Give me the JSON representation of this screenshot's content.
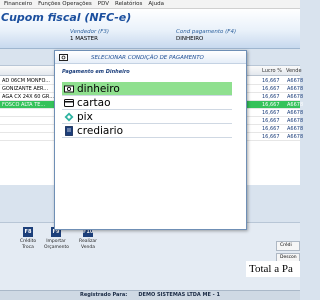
{
  "menu": [
    "Financeiro",
    "Funções Operações",
    "PDV",
    "Relatórios",
    "Ajuda"
  ],
  "header": {
    "title": "Cupom fiscal (NFC-e)",
    "vendedor_label": "Vendedor (F3)",
    "vendedor_value": "1  MASTER",
    "cond_label": "Cond pagamento (F4)",
    "cond_value": "DINHEIRO"
  },
  "grid": {
    "columns": [
      "Lucro %",
      "Vende"
    ],
    "rows": [
      {
        "desc": "AD 06CM MONFO...",
        "c1": "16,667",
        "c2": "A6678"
      },
      {
        "desc": "GONIZANTE AER...",
        "c1": "16,667",
        "c2": "A6678"
      },
      {
        "desc": "AGA CX 24X 60 GR...",
        "c1": "16,667",
        "c2": "A6678"
      },
      {
        "desc": "FOSCO ALTA TE...",
        "c1": "16,667",
        "c2": "A6678"
      },
      {
        "desc": "",
        "c1": "16,667",
        "c2": "A6678"
      },
      {
        "desc": "",
        "c1": "16,667",
        "c2": "A6678"
      },
      {
        "desc": "",
        "c1": "16,667",
        "c2": "A6678"
      },
      {
        "desc": "",
        "c1": "16,667",
        "c2": "A6678"
      }
    ]
  },
  "modal": {
    "title": "SELECIONAR CONDIÇÃO DE PAGAMENTO",
    "subtitle": "Pagamento em Dinheiro",
    "options": [
      {
        "label": "dinheiro",
        "icon": "cash-icon"
      },
      {
        "label": "cartao",
        "icon": "card-icon"
      },
      {
        "label": "pix",
        "icon": "pix-icon"
      },
      {
        "label": "crediario",
        "icon": "notebook-icon"
      }
    ],
    "selected_index": 0
  },
  "toolbar": {
    "tools": [
      {
        "key": "F8",
        "label": "Crédito\nTroca"
      },
      {
        "key": "F9",
        "label": "Importar\nOrçamento"
      },
      {
        "key": "F10",
        "label": "Realizar\nVenda"
      }
    ],
    "btn1": "Crédi",
    "btn2": "Descon",
    "total": "Total a Pa"
  },
  "status": {
    "label": "Registrado Para:",
    "value": "DEMO SISTEMAS LTDA ME - 1"
  },
  "colors": {
    "accent": "#1b4f9e",
    "selected_row": "#35c25a",
    "selected_option": "#8fe08f"
  }
}
